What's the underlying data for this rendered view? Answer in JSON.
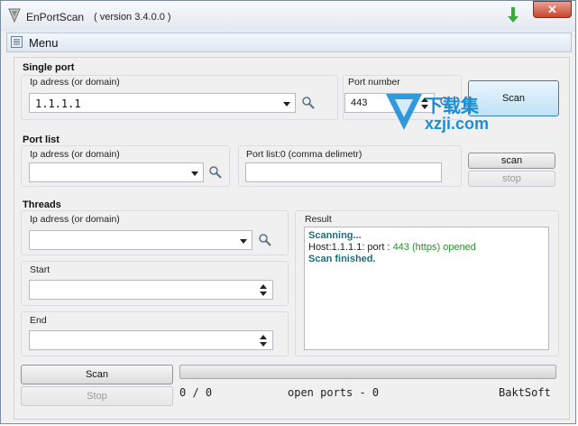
{
  "window": {
    "title": "EnPortScan",
    "version": "( version 3.4.0.0 )",
    "close_glyph": "✕"
  },
  "menu": {
    "label": "Menu"
  },
  "single_port": {
    "section_title": "Single port",
    "ip_label": "Ip adress (or domain)",
    "ip_value": "1.1.1.1",
    "port_label": "Port number",
    "port_value": "443",
    "scan_label": "Scan"
  },
  "port_list": {
    "section_title": "Port list",
    "ip_label": "Ip adress (or domain)",
    "ip_value": "",
    "list_label": "Port list:0  (comma delimetr)",
    "list_value": "",
    "scan_label": "scan",
    "stop_label": "stop"
  },
  "threads": {
    "section_title": "Threads",
    "ip_label": "Ip adress (or domain)",
    "ip_value": "",
    "start_label": "Start",
    "start_value": "",
    "end_label": "End",
    "end_value": ""
  },
  "result": {
    "label": "Result",
    "lines": [
      {
        "parts": [
          {
            "text": "Scanning...",
            "color": "#1d6f7a",
            "bold": true
          }
        ]
      },
      {
        "parts": [
          {
            "text": "Host:1.1.1.1: port : ",
            "color": "#222222",
            "bold": false
          },
          {
            "text": "443 (https)",
            "color": "#2e8b2e",
            "bold": false
          },
          {
            "text": "  opened",
            "color": "#2e8b2e",
            "bold": false
          }
        ]
      },
      {
        "parts": [
          {
            "text": "Scan finished.",
            "color": "#1d6f7a",
            "bold": true
          }
        ]
      }
    ]
  },
  "bottom": {
    "scan_label": "Scan",
    "stop_label": "Stop",
    "progress_value": 0,
    "count_text": "0 / 0",
    "open_ports_text": "open ports - 0",
    "brand_text": "BaktSoft"
  },
  "watermark": {
    "line1": "下载集",
    "line2": "xzji.com"
  },
  "colors": {
    "accent": "#1a8fd8",
    "close": "#c8452c",
    "arrow": "#3aa83a"
  }
}
